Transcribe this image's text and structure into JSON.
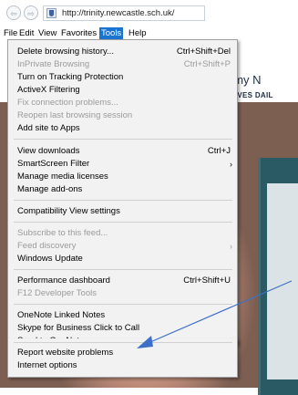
{
  "browser": {
    "url": "http://trinity.newcastle.sch.uk/",
    "back_glyph": "⇦",
    "forward_glyph": "⇨"
  },
  "menubar": [
    "File",
    "Edit",
    "View",
    "Favorites",
    "Tools",
    "Help"
  ],
  "page": {
    "heading": "cademy N",
    "subheading": "GE LIVES DAIL"
  },
  "tools_menu": {
    "items": [
      {
        "label": "Delete browsing history...",
        "shortcut": "Ctrl+Shift+Del",
        "disabled": false
      },
      {
        "label": "InPrivate Browsing",
        "shortcut": "Ctrl+Shift+P",
        "disabled": true
      },
      {
        "label": "Turn on Tracking Protection",
        "shortcut": "",
        "disabled": false
      },
      {
        "label": "ActiveX Filtering",
        "shortcut": "",
        "disabled": false
      },
      {
        "label": "Fix connection problems...",
        "shortcut": "",
        "disabled": true
      },
      {
        "label": "Reopen last browsing session",
        "shortcut": "",
        "disabled": true
      },
      {
        "label": "Add site to Apps",
        "shortcut": "",
        "disabled": false
      },
      {
        "label": "View downloads",
        "shortcut": "Ctrl+J",
        "disabled": false
      },
      {
        "label": "SmartScreen Filter",
        "shortcut": "",
        "disabled": false,
        "submenu": true
      },
      {
        "label": "Manage media licenses",
        "shortcut": "",
        "disabled": false
      },
      {
        "label": "Manage add-ons",
        "shortcut": "",
        "disabled": false
      },
      {
        "label": "Compatibility View settings",
        "shortcut": "",
        "disabled": false
      },
      {
        "label": "Subscribe to this feed...",
        "shortcut": "",
        "disabled": true
      },
      {
        "label": "Feed discovery",
        "shortcut": "",
        "disabled": true,
        "submenu": true
      },
      {
        "label": "Windows Update",
        "shortcut": "",
        "disabled": false
      },
      {
        "label": "Performance dashboard",
        "shortcut": "Ctrl+Shift+U",
        "disabled": false
      },
      {
        "label": "F12 Developer Tools",
        "shortcut": "",
        "disabled": false
      },
      {
        "label": "OneNote Linked Notes",
        "shortcut": "",
        "disabled": false
      },
      {
        "label": "Skype for Business Click to Call",
        "shortcut": "",
        "disabled": false
      },
      {
        "label": "Send to OneNote",
        "shortcut": "",
        "disabled": false
      },
      {
        "label": "Report website problems",
        "shortcut": "",
        "disabled": false
      },
      {
        "label": "Internet options",
        "shortcut": "",
        "disabled": false
      }
    ],
    "submenu_glyph": "›"
  },
  "colors": {
    "menu_highlight": "#1b75d0",
    "annotation_arrow": "#3d6fc8"
  }
}
